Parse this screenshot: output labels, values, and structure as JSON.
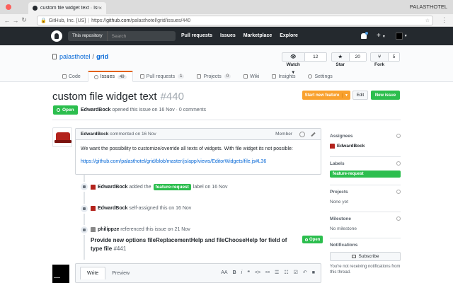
{
  "browser": {
    "tab_title": "custom file widget text · Issue",
    "profile": "PALASTHOTEL",
    "security_label": "GitHub, Inc. [US]",
    "url_scheme": "https://",
    "url_host": "github.com",
    "url_path": "/palasthotel/grid/issues/440"
  },
  "header": {
    "scope": "This repository",
    "search_placeholder": "Search",
    "nav": [
      "Pull requests",
      "Issues",
      "Marketplace",
      "Explore"
    ],
    "plus": "+"
  },
  "repo": {
    "owner": "palasthotel",
    "slash": "/",
    "name": "grid",
    "watch_label": "Watch",
    "watch_count": "12",
    "star_label": "Star",
    "star_count": "20",
    "fork_label": "Fork",
    "fork_count": "5",
    "tabs": [
      {
        "label": "Code",
        "count": ""
      },
      {
        "label": "Issues",
        "count": "49"
      },
      {
        "label": "Pull requests",
        "count": "1"
      },
      {
        "label": "Projects",
        "count": "0"
      },
      {
        "label": "Wiki",
        "count": ""
      },
      {
        "label": "Insights",
        "count": ""
      },
      {
        "label": "Settings",
        "count": ""
      }
    ]
  },
  "issue": {
    "title": "custom file widget text",
    "number": "#440",
    "start_label": "Start new feature",
    "edit_label": "Edit",
    "new_label": "New issue",
    "state": "Open",
    "author": "EdwardBock",
    "meta_text": "opened this issue on 16 Nov · 0 comments"
  },
  "comment": {
    "author": "EdwardBock",
    "time": "commented on 16 Nov",
    "role": "Member",
    "body": "We want the possibility to customize/override all texts of widgets. With file widget its not possible:",
    "link": "https://github.com/palasthotel/grid/blob/master/js/app/views/EditorWidgets/file.js#L36"
  },
  "timeline": [
    {
      "actor": "EdwardBock",
      "pre": "added the",
      "label": "feature-request",
      "post": "label on 16 Nov"
    },
    {
      "actor": "EdwardBock",
      "pre": "self-assigned this on 16 Nov",
      "label": "",
      "post": ""
    },
    {
      "actor": "philippze",
      "pre": "referenced this issue on 21 Nov",
      "label": "",
      "post": ""
    }
  ],
  "reference": {
    "title": "Provide new options fileReplacementHelp and fileChooseHelp for field of type file",
    "number": "#441",
    "state": "Open"
  },
  "editor": {
    "write": "Write",
    "preview": "Preview",
    "toolbar": [
      "AA",
      "B",
      "i",
      "❝",
      "<>",
      "⚯",
      "☰",
      "☷",
      "☑",
      "↶",
      "■"
    ]
  },
  "sidebar": {
    "assignees_h": "Assignees",
    "assignee": "EdwardBock",
    "labels_h": "Labels",
    "label": "feature-request",
    "projects_h": "Projects",
    "projects_v": "None yet",
    "milestone_h": "Milestone",
    "milestone_v": "No milestone",
    "notifications_h": "Notifications",
    "subscribe": "Subscribe",
    "sub_note": "You're not receiving notifications from this thread."
  },
  "colors": {
    "header_bg": "#24292e",
    "link": "#0366d6",
    "green": "#2cbe4e",
    "orange": "#f9a12e"
  }
}
